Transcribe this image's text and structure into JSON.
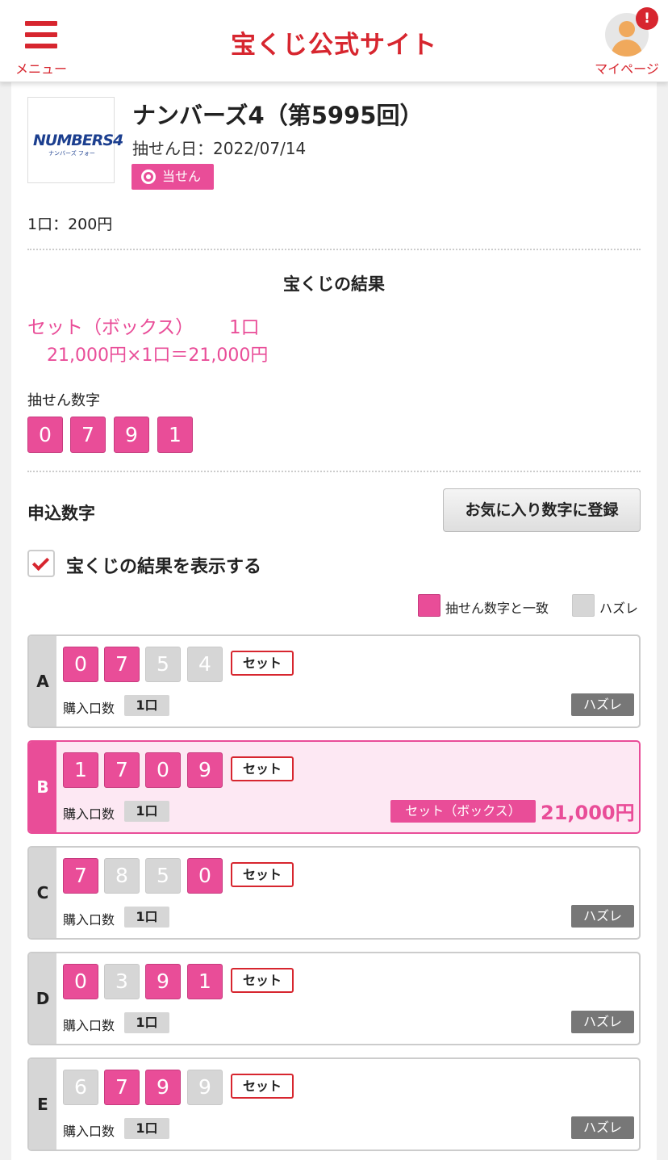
{
  "header": {
    "menu_label": "メニュー",
    "logo": "宝くじ公式サイト",
    "mypage_label": "マイページ",
    "notification": "!"
  },
  "product": {
    "logo_text": "NUMBERS4",
    "logo_sub": "ナンバーズ フォー",
    "title": "ナンバーズ4（第5995回）",
    "draw_date": "抽せん日：2022/07/14",
    "status_badge": "当せん",
    "price": "1口：200円"
  },
  "result": {
    "title": "宝くじの結果",
    "prize_type": "セット（ボックス）",
    "prize_count": "1口",
    "prize_calc": "21,000円×1口＝21,000円",
    "draw_numbers_label": "抽せん数字",
    "draw_numbers": [
      "0",
      "7",
      "9",
      "1"
    ]
  },
  "application": {
    "label": "申込数字",
    "favorite_button": "お気に入り数字に登録",
    "show_result_label": "宝くじの結果を表示する",
    "legend_match": "抽せん数字と一致",
    "legend_miss": "ハズレ",
    "rows": [
      {
        "letter": "A",
        "digits": [
          "0",
          "7",
          "5",
          "4"
        ],
        "type": "セット",
        "qty_label": "購入口数",
        "qty": "1口",
        "result": "ハズレ"
      },
      {
        "letter": "B",
        "digits": [
          "1",
          "7",
          "0",
          "9"
        ],
        "type": "セット",
        "qty_label": "購入口数",
        "qty": "1口",
        "result": "セット（ボックス）",
        "amount": "21,000円"
      },
      {
        "letter": "C",
        "digits": [
          "7",
          "8",
          "5",
          "0"
        ],
        "type": "セット",
        "qty_label": "購入口数",
        "qty": "1口",
        "result": "ハズレ"
      },
      {
        "letter": "D",
        "digits": [
          "0",
          "3",
          "9",
          "1"
        ],
        "type": "セット",
        "qty_label": "購入口数",
        "qty": "1口",
        "result": "ハズレ"
      },
      {
        "letter": "E",
        "digits": [
          "6",
          "7",
          "9",
          "9"
        ],
        "type": "セット",
        "qty_label": "購入口数",
        "qty": "1口",
        "result": "ハズレ"
      }
    ]
  },
  "colors": {
    "brand_red": "#d7262f",
    "match_pink": "#e94d98",
    "miss_gray": "#d6d6d6",
    "miss_badge": "#777777",
    "win_row_bg": "#fde8f3"
  }
}
